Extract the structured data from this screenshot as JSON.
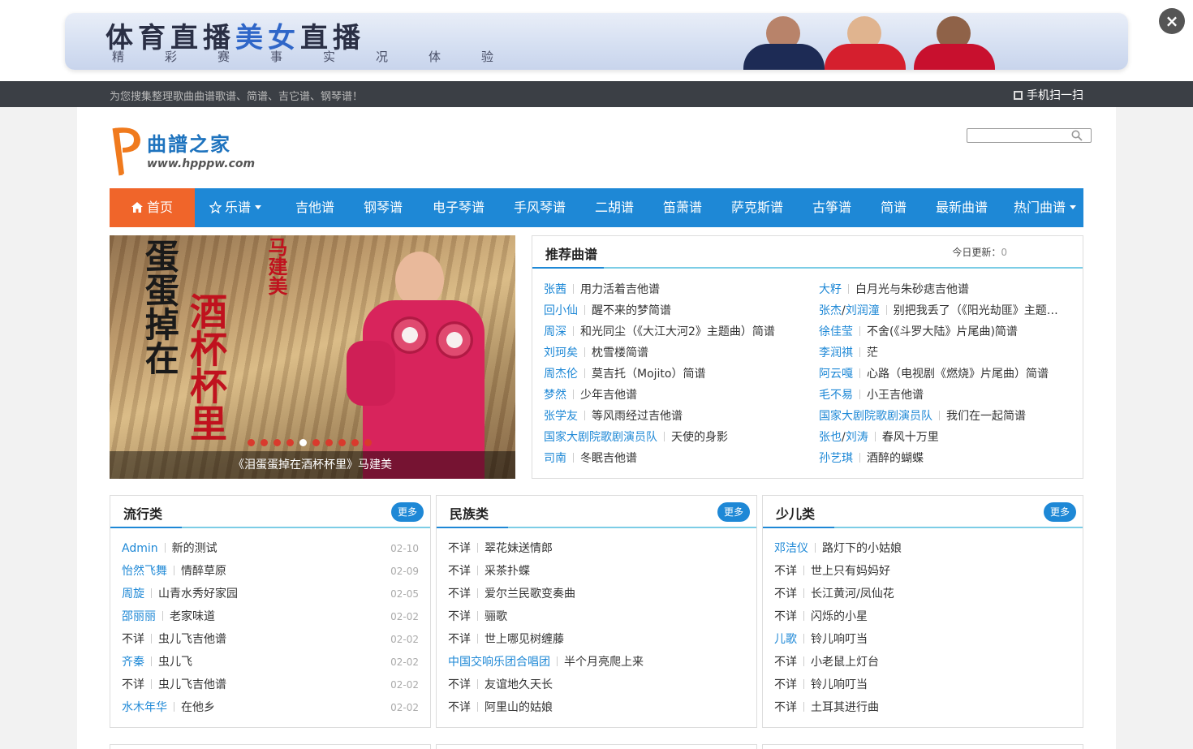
{
  "ad": {
    "title_a": "体育直播",
    "title_b": "美女",
    "title_c": "直播",
    "subtitle": "精彩赛事实况体验",
    "close": "×"
  },
  "topbar": {
    "tagline": "为您搜集整理歌曲曲谱歌谱、简谱、吉它谱、钢琴谱！",
    "mobile_scan": "手机扫一扫"
  },
  "logo": {
    "name": "曲譜之家",
    "url": "www.hpppw.com"
  },
  "search": {
    "placeholder": ""
  },
  "nav": [
    {
      "label": "首页",
      "icon": "home-icon",
      "active": true
    },
    {
      "label": "乐谱",
      "icon": "star-icon",
      "dropdown": true
    },
    {
      "label": "吉他谱"
    },
    {
      "label": "钢琴谱"
    },
    {
      "label": "电子琴谱"
    },
    {
      "label": "手风琴谱"
    },
    {
      "label": "二胡谱"
    },
    {
      "label": "笛萧谱"
    },
    {
      "label": "萨克斯谱"
    },
    {
      "label": "古筝谱"
    },
    {
      "label": "简谱"
    },
    {
      "label": "最新曲谱"
    },
    {
      "label": "热门曲谱",
      "dropdown": true
    }
  ],
  "slider": {
    "caption": "《泪蛋蛋掉在酒杯杯里》马建美",
    "art_text": {
      "left": "蛋蛋掉在",
      "right": "酒杯杯里",
      "top": "马建美"
    },
    "dot_count": 10,
    "active_dot": 4
  },
  "recommend": {
    "title": "推荐曲谱",
    "today_label": "今日更新：",
    "today_count": "0",
    "left": [
      {
        "artist": "张茜",
        "song": "用力活着吉他谱"
      },
      {
        "artist": "回小仙",
        "song": "醒不来的梦简谱"
      },
      {
        "artist": "周深",
        "song": "和光同尘（《大江大河2》主题曲）简谱"
      },
      {
        "artist": "刘珂矣",
        "song": "枕雪楼简谱"
      },
      {
        "artist": "周杰伦",
        "song": "莫吉托（Mojito）简谱"
      },
      {
        "artist": "梦然",
        "song": "少年吉他谱"
      },
      {
        "artist": "张学友",
        "song": "等风雨经过吉他谱"
      },
      {
        "artist": "国家大剧院歌剧演员队",
        "song": "天使的身影"
      },
      {
        "artist": "司南",
        "song": "冬眠吉他谱"
      }
    ],
    "right": [
      {
        "artist": "大籽",
        "song": "白月光与朱砂痣吉他谱"
      },
      {
        "artist": "张杰",
        "artist2": "刘润潼",
        "song": "别把我丢了（《阳光劫匪》主题曲）简谱"
      },
      {
        "artist": "徐佳莹",
        "song": "不舍(《斗罗大陆》片尾曲)简谱"
      },
      {
        "artist": "李润祺",
        "song": "茫"
      },
      {
        "artist": "阿云嘎",
        "song": "心路（电视剧《燃烧》片尾曲）简谱"
      },
      {
        "artist": "毛不易",
        "song": "小王吉他谱"
      },
      {
        "artist": "国家大剧院歌剧演员队",
        "song": "我们在一起简谱"
      },
      {
        "artist": "张也",
        "artist2": "刘涛",
        "song": "春风十万里"
      },
      {
        "artist": "孙艺琪",
        "song": "酒醉的蝴蝶"
      }
    ]
  },
  "panels": [
    {
      "title": "流行类",
      "more": "更多",
      "items": [
        {
          "artist": "Admin",
          "song": "新的测试",
          "date": "02-10",
          "link": true
        },
        {
          "artist": "怡然飞舞",
          "song": "情醉草原",
          "date": "02-09",
          "link": true
        },
        {
          "artist": "周旋",
          "song": "山青水秀好家园",
          "date": "02-05",
          "link": true
        },
        {
          "artist": "邵丽丽",
          "song": "老家味道",
          "date": "02-02",
          "link": true
        },
        {
          "artist": "不详",
          "song": "虫儿飞吉他谱",
          "date": "02-02",
          "link": false
        },
        {
          "artist": "齐秦",
          "song": "虫儿飞",
          "date": "02-02",
          "link": true
        },
        {
          "artist": "不详",
          "song": "虫儿飞吉他谱",
          "date": "02-02",
          "link": false
        },
        {
          "artist": "水木年华",
          "song": "在他乡",
          "date": "02-02",
          "link": true
        }
      ]
    },
    {
      "title": "民族类",
      "more": "更多",
      "items": [
        {
          "artist": "不详",
          "song": "翠花妹送情郎",
          "link": false
        },
        {
          "artist": "不详",
          "song": "采茶扑蝶",
          "link": false
        },
        {
          "artist": "不详",
          "song": "爱尔兰民歌变奏曲",
          "link": false
        },
        {
          "artist": "不详",
          "song": "骊歌",
          "link": false
        },
        {
          "artist": "不详",
          "song": "世上哪见树缠藤",
          "link": false
        },
        {
          "artist": "中国交响乐团合唱团",
          "song": "半个月亮爬上来",
          "link": true
        },
        {
          "artist": "不详",
          "song": "友谊地久天长",
          "link": false
        },
        {
          "artist": "不详",
          "song": "阿里山的姑娘",
          "link": false
        }
      ]
    },
    {
      "title": "少儿类",
      "more": "更多",
      "items": [
        {
          "artist": "邓洁仪",
          "song": "路灯下的小姑娘",
          "link": true
        },
        {
          "artist": "不详",
          "song": "世上只有妈妈好",
          "link": false
        },
        {
          "artist": "不详",
          "song": "长江黄河/凤仙花",
          "link": false
        },
        {
          "artist": "不详",
          "song": "闪烁的小星",
          "link": false
        },
        {
          "artist": "儿歌",
          "song": "铃儿响叮当",
          "link": true
        },
        {
          "artist": "不详",
          "song": "小老鼠上灯台",
          "link": false
        },
        {
          "artist": "不详",
          "song": "铃儿响叮当",
          "link": false
        },
        {
          "artist": "不详",
          "song": "土耳其进行曲",
          "link": false
        }
      ]
    }
  ],
  "colors": {
    "accent": "#1e88d6",
    "nav_active": "#f0652a",
    "topbar": "#3b3f45",
    "link": "#1e88d6"
  }
}
